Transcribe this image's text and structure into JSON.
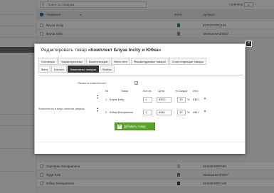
{
  "search": {
    "placeholder": "Поиск по товарам"
  },
  "pager": {
    "label": "страница",
    "page": "1"
  },
  "grid": {
    "headers": {
      "name": "Название",
      "photo": "Фото",
      "article": "Артикул"
    },
    "rows": [
      {
        "name": "Блуза Incity",
        "article": "IN002EWBQHI5"
      },
      {
        "name": "Блуза Sela",
        "article": "SE001EWAEW32"
      },
      {
        "name": "Сарафан Sinequanone",
        "article": "SI654EWBD699"
      },
      {
        "name": "Худи Sela",
        "article": "SE001EWAEW67"
      },
      {
        "name": "Юбка Sinequanone",
        "article": "SI654EWBDA69"
      }
    ]
  },
  "modal": {
    "title_prefix": "Редактировать товар",
    "title_name": "«Комплект Блуза Incity и Юбка»",
    "close_glyph": "×",
    "tabs_row1": [
      "Основные",
      "Характеристики",
      "Комплектации",
      "Мета-теги",
      "Рекомендуемые товары",
      "Сопутствующие товары"
    ],
    "tabs_row2": [
      "Фото",
      "Налоги",
      "Комплекты товаров",
      "Файлы"
    ],
    "active_tab": "Комплекты товаров",
    "is_kit_label": "Является комплектом?",
    "is_kit_checked": "✓",
    "components_label": "Компоненты в виде наличия (медиа)",
    "table": {
      "headers": {
        "num": "№",
        "product": "Товар",
        "qty": "Кол-во",
        "price": "Цена",
        "discount": "% Скидка",
        "total": "Итог"
      },
      "rows": [
        {
          "num": "1",
          "product": "Блуза Incity",
          "qty": "1",
          "price": "599.1",
          "discount": "10",
          "pct": "%",
          "total": "539.1"
        },
        {
          "num": "2",
          "product": "Юбка Sinequanone",
          "qty": "1",
          "price": "4541",
          "discount": "10",
          "pct": "%",
          "total": "4541"
        }
      ]
    },
    "add_button": "Добавить товар"
  }
}
